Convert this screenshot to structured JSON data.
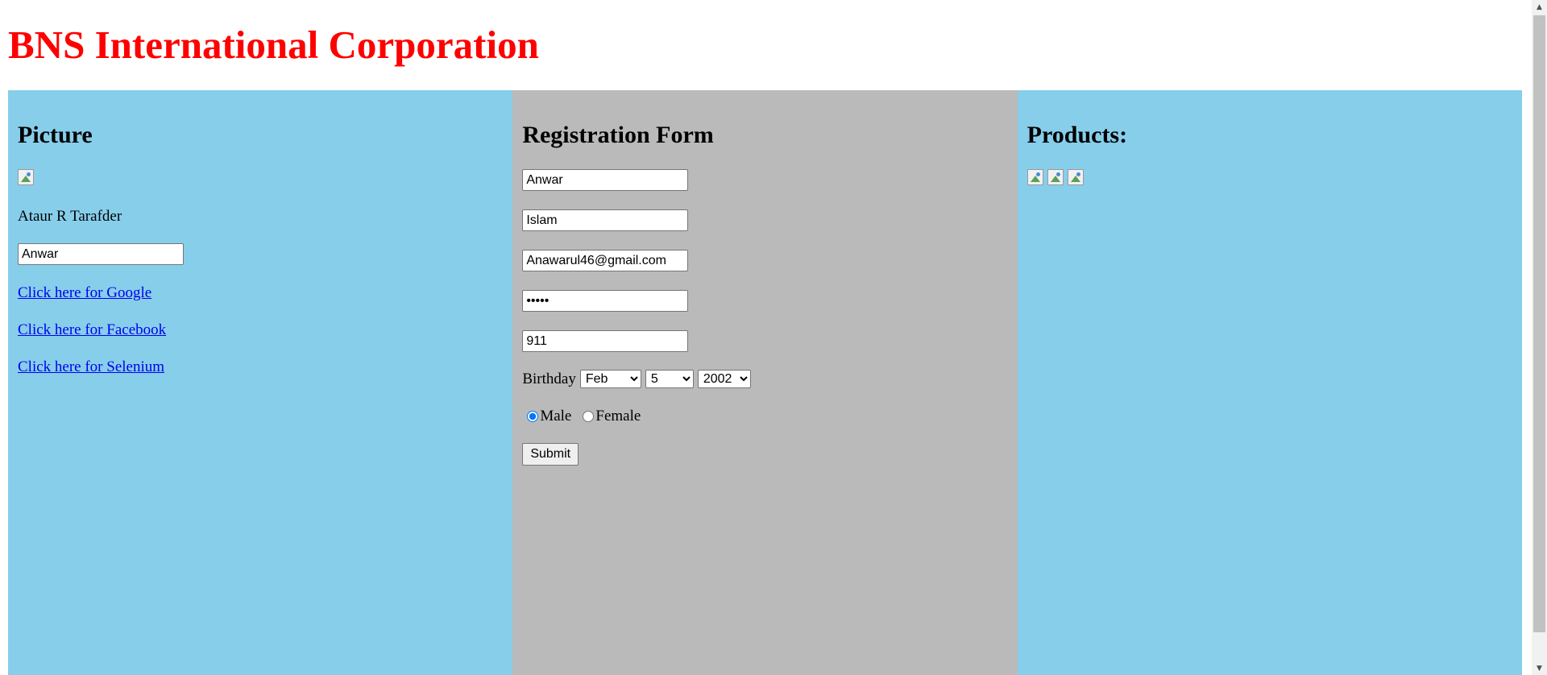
{
  "site": {
    "title": "BNS International Corporation"
  },
  "colors": {
    "title": "#ff0000",
    "left_panel": "#87ceeb",
    "middle_panel": "#bababa",
    "right_panel": "#87ceeb",
    "link": "#0000ee"
  },
  "left": {
    "heading": "Picture",
    "image_icon": "broken-image-icon",
    "person_name": "Ataur R Tarafder",
    "name_input_value": "Anwar",
    "links": [
      {
        "label": "Click here for Google"
      },
      {
        "label": "Click here for Facebook"
      },
      {
        "label": "Click here for Selenium"
      }
    ]
  },
  "form": {
    "heading": "Registration Form",
    "first_name": "Anwar",
    "last_name": "Islam",
    "email": "Anawarul46@gmail.com",
    "password": "•••••",
    "phone": "911",
    "birthday_label": "Birthday",
    "birthday_month": "Feb",
    "birthday_day": "5",
    "birthday_year": "2002",
    "gender_options": [
      "Male",
      "Female"
    ],
    "gender_selected": "Male",
    "submit_label": "Submit"
  },
  "right": {
    "heading": "Products:",
    "product_images": [
      "broken-image-icon",
      "broken-image-icon",
      "broken-image-icon"
    ]
  },
  "scrollbar": {
    "up_icon": "▲",
    "down_icon": "▼"
  }
}
